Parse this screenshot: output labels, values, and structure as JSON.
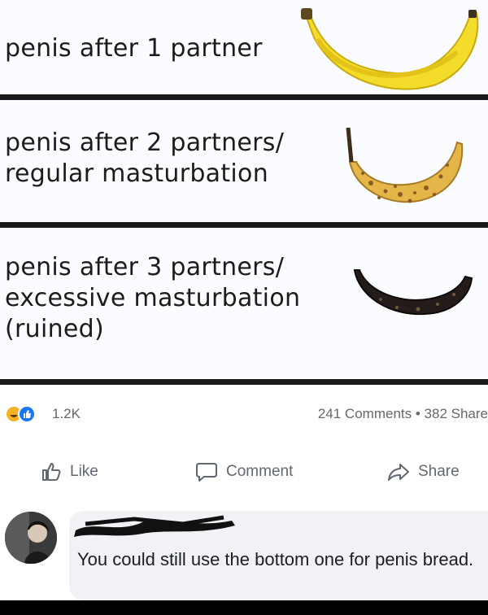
{
  "meme": {
    "panels": [
      {
        "text": "penis after 1 partner",
        "banana": "fresh-yellow-banana"
      },
      {
        "text": "penis after 2 partners/\nregular masturbation",
        "banana": "spotted-ripe-banana"
      },
      {
        "text": "penis after 3 partners/\nexcessive masturbation\n(ruined)",
        "banana": "blackened-overripe-banana"
      }
    ],
    "colors": {
      "panel_bg": "#fbfcff",
      "divider": "#1a1a1a",
      "fresh": "#f4dc2a",
      "ripe": "#e4b64a",
      "rotten": "#241c1a"
    }
  },
  "post": {
    "reaction_count": "1.2K",
    "comments_count": "241 Comments",
    "separator": "•",
    "shares_count": "382 Share",
    "actions": {
      "like": "Like",
      "comment": "Comment",
      "share": "Share"
    },
    "reaction_icons": [
      "haha-icon",
      "like-icon"
    ]
  },
  "comment": {
    "author_name_redacted": true,
    "text": "You could still use the bottom one for penis bread."
  }
}
